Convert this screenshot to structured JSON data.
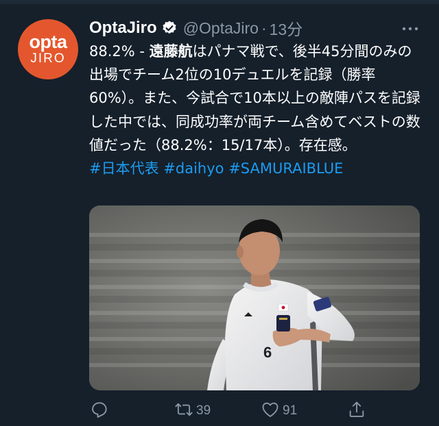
{
  "tweet": {
    "avatar": {
      "line1": "opta",
      "line2": "JIRO"
    },
    "display_name": "OptaJiro",
    "handle": "@OptaJiro",
    "separator": "·",
    "time": "13分",
    "body": {
      "lead": "88.2% - ",
      "player": "遠藤航",
      "text": "はパナマ戦で、後半45分間のみの出場でチーム2位の10デュエルを記録（勝率60%）。また、今試合で10本以上の敵陣パスを記録した中では、同成功率が両チーム含めてベストの数値だった（88.2%：15/17本）。存在感。"
    },
    "hashtags": [
      "#日本代表",
      "#daihyo",
      "#SAMURAIBLUE"
    ],
    "media": {
      "jersey_number": "6"
    },
    "stats": {
      "retweets": "39",
      "likes": "91"
    },
    "icons": {
      "verified": "verified-badge-icon",
      "more": "more-options-icon",
      "reply": "reply-icon",
      "retweet": "retweet-icon",
      "like": "heart-icon",
      "share": "share-icon"
    },
    "colors": {
      "background": "#15202b",
      "text": "#ffffff",
      "secondary": "#8b98a5",
      "link": "#1d9bf0",
      "avatar": "#e4572e"
    }
  }
}
